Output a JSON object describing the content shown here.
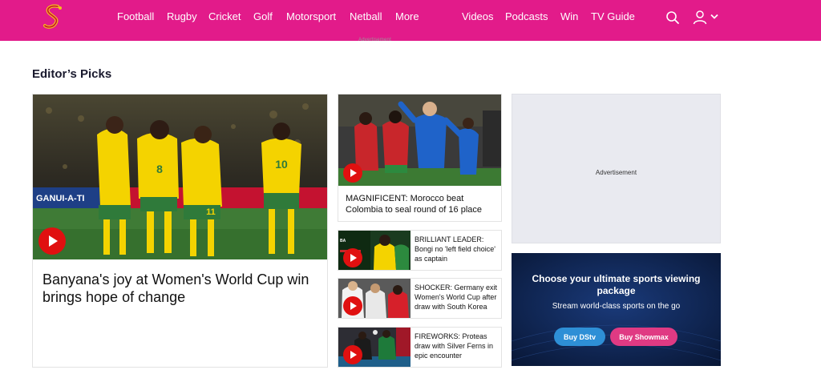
{
  "nav": {
    "links": [
      "Football",
      "Rugby",
      "Cricket",
      "Golf",
      "Motorsport",
      "Netball",
      "More",
      "Videos",
      "Podcasts",
      "Win",
      "TV Guide"
    ],
    "brand_color": "#e21b8a",
    "icons": [
      "supersport-logo",
      "search-icon",
      "user-icon",
      "chevron-down-icon"
    ]
  },
  "ad_tiny": "Advertisement",
  "section": {
    "title": "Editor’s Picks"
  },
  "hero": {
    "title": "Banyana's joy at Women's World Cup win brings hope of change"
  },
  "mid_card": {
    "title": "MAGNIFICENT: Morocco beat Colombia to seal round of 16 place"
  },
  "small_cards": [
    {
      "title": "BRILLIANT LEADER: Bongi no 'left field choice' as captain"
    },
    {
      "title": "SHOCKER: Germany exit Women's World Cup after draw with South Korea"
    },
    {
      "title": "FIREWORKS: Proteas draw with Silver Ferns in epic encounter"
    }
  ],
  "ad": {
    "label": "Advertisement"
  },
  "promo": {
    "title": "Choose your ultimate sports viewing package",
    "subtitle": "Stream world-class sports on the go",
    "buy_dstv": "Buy DStv",
    "buy_showmax": "Buy Showmax"
  },
  "colors": {
    "play_button": "#e01010",
    "dstv": "#2e8fd6",
    "showmax": "#e03a83",
    "promo_bg": "#0c1f4a"
  }
}
